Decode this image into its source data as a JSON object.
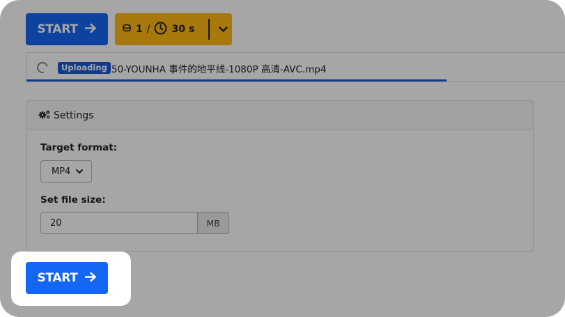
{
  "toolbar": {
    "start_label": "START",
    "credits": {
      "count": "1",
      "separator": "/",
      "duration": "30 s"
    }
  },
  "upload": {
    "status_badge": "Uploading",
    "filename": "50-YOUNHA 事件的地平线-1080P 高清-AVC.mp4",
    "progress_percent": 78
  },
  "settings": {
    "title": "Settings",
    "target_format_label": "Target format:",
    "target_format_value": "MP4",
    "file_size_label": "Set file size:",
    "file_size_value": "20",
    "file_size_unit": "MB"
  },
  "colors": {
    "primary": "#1466f5",
    "warning": "#ffb814",
    "badge": "#1c5ad8"
  },
  "icons": {
    "start": "arrow-right-icon",
    "credits": "coin-icon",
    "time": "clock-icon",
    "dropdown": "chevron-down-icon",
    "settings": "gears-icon",
    "uploading": "spinner-icon"
  }
}
